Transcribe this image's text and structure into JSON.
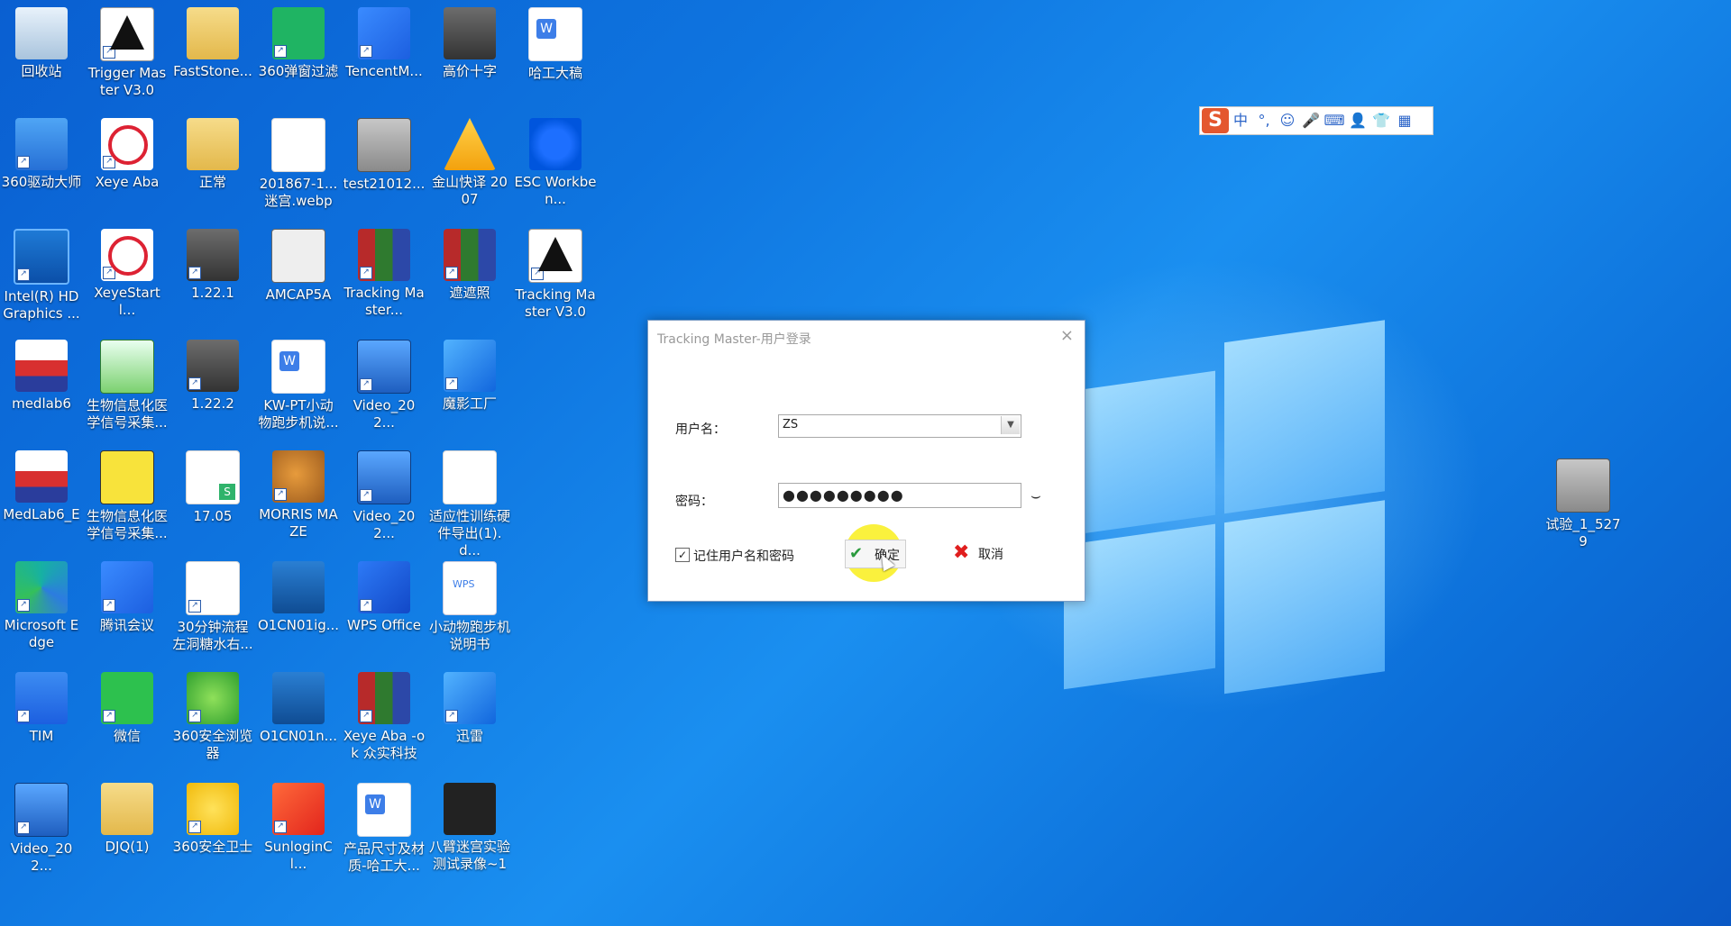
{
  "desktop": {
    "icons": [
      {
        "label": "回收站"
      },
      {
        "label": "Trigger Master V3.0"
      },
      {
        "label": "FastStone..."
      },
      {
        "label": "360弹窗过滤"
      },
      {
        "label": "TencentM..."
      },
      {
        "label": "高价十字"
      },
      {
        "label": "哈工大稿"
      },
      {
        "label": "360驱动大师"
      },
      {
        "label": "Xeye Aba"
      },
      {
        "label": "正常"
      },
      {
        "label": "201867-1...迷宫.webp"
      },
      {
        "label": "test21012..."
      },
      {
        "label": "金山快译 2007"
      },
      {
        "label": "ESC Workben..."
      },
      {
        "label": "Intel(R) HD Graphics ..."
      },
      {
        "label": "XeyeStartl..."
      },
      {
        "label": "1.22.1"
      },
      {
        "label": "AMCAP5A"
      },
      {
        "label": "Tracking Master..."
      },
      {
        "label": "遮遮照"
      },
      {
        "label": "Tracking Master V3.0"
      },
      {
        "label": "medlab6"
      },
      {
        "label": "生物信息化医学信号采集..."
      },
      {
        "label": "1.22.2"
      },
      {
        "label": "KW-PT小动物跑步机说..."
      },
      {
        "label": "Video_202..."
      },
      {
        "label": "魔影工厂"
      },
      {
        "label": "MedLab6_E"
      },
      {
        "label": "生物信息化医学信号采集..."
      },
      {
        "label": "17.05"
      },
      {
        "label": "MORRIS MAZE"
      },
      {
        "label": "Video_202..."
      },
      {
        "label": "适应性训练硬件导出(1).d..."
      },
      {
        "label": "Microsoft Edge"
      },
      {
        "label": "腾讯会议"
      },
      {
        "label": "30分钟流程左洞糖水右..."
      },
      {
        "label": "O1CN01ig..."
      },
      {
        "label": "WPS Office"
      },
      {
        "label": "小动物跑步机说明书"
      },
      {
        "label": "TIM"
      },
      {
        "label": "微信"
      },
      {
        "label": "360安全浏览器"
      },
      {
        "label": "O1CN01n..."
      },
      {
        "label": "Xeye Aba -ok 众实科技"
      },
      {
        "label": "迅雷"
      },
      {
        "label": "Video_202..."
      },
      {
        "label": "DJQ(1)"
      },
      {
        "label": "360安全卫士"
      },
      {
        "label": "SunloginCl..."
      },
      {
        "label": "产品尺寸及材质-哈工大..."
      },
      {
        "label": "八臂迷宫实验测试录像~1"
      },
      {
        "label": "试验_1_5279"
      }
    ]
  },
  "ime": {
    "logo": "S",
    "mode": "中",
    "punct": "°,",
    "emoji": "☺",
    "voice": "🎤",
    "keyboard": "⌨",
    "user": "👤",
    "skin": "👕",
    "tools": "▦"
  },
  "dialog": {
    "title": "Tracking Master-用户登录",
    "close": "×",
    "username_label": "用户名：",
    "username_value": "ZS",
    "password_label": "密码：",
    "password_value": "●●●●●●●●●",
    "remember_label": "记住用户名和密码",
    "remember_checked": "✓",
    "ok_label": "确定",
    "cancel_label": "取消"
  }
}
